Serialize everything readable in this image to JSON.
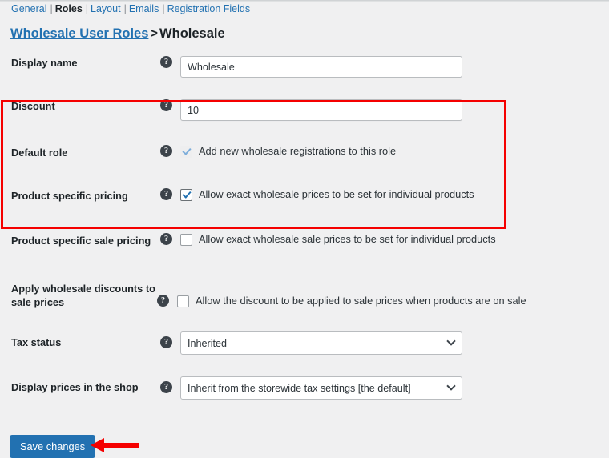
{
  "subnav": {
    "tabs": [
      {
        "label": "General",
        "active": false
      },
      {
        "label": "Roles",
        "active": true
      },
      {
        "label": "Layout",
        "active": false
      },
      {
        "label": "Emails",
        "active": false
      },
      {
        "label": "Registration Fields",
        "active": false
      }
    ],
    "separator": "|"
  },
  "heading": {
    "parent_link": "Wholesale User Roles",
    "separator": ">",
    "current": "Wholesale"
  },
  "rows": {
    "display_name": {
      "label": "Display name",
      "value": "Wholesale",
      "help": "?"
    },
    "discount": {
      "label": "Discount",
      "value": "10",
      "help": "?"
    },
    "default_role": {
      "label": "Default role",
      "checkbox_label": "Add new wholesale registrations to this role",
      "checked": true,
      "disabled": true,
      "help": "?"
    },
    "product_specific_pricing": {
      "label": "Product specific pricing",
      "checkbox_label": "Allow exact wholesale prices to be set for individual products",
      "checked": true,
      "disabled": false,
      "help": "?"
    },
    "product_specific_sale_pricing": {
      "label": "Product specific sale pricing",
      "checkbox_label": "Allow exact wholesale sale prices to be set for individual products",
      "checked": false,
      "disabled": false,
      "help": "?"
    },
    "apply_wholesale_discounts": {
      "label": "Apply wholesale discounts to sale prices",
      "checkbox_label": "Allow the discount to be applied to sale prices when products are on sale",
      "checked": false,
      "disabled": false,
      "help": "?"
    },
    "tax_status": {
      "label": "Tax status",
      "value": "Inherited",
      "help": "?"
    },
    "display_prices": {
      "label": "Display prices in the shop",
      "value": "Inherit from the storewide tax settings [the default]",
      "help": "?"
    }
  },
  "footer": {
    "save_label": "Save changes"
  },
  "annotations": {
    "highlight_color": "#f50000",
    "arrow_color": "#f50000",
    "accent_color": "#2271b1",
    "background_color": "#f0f0f1"
  }
}
